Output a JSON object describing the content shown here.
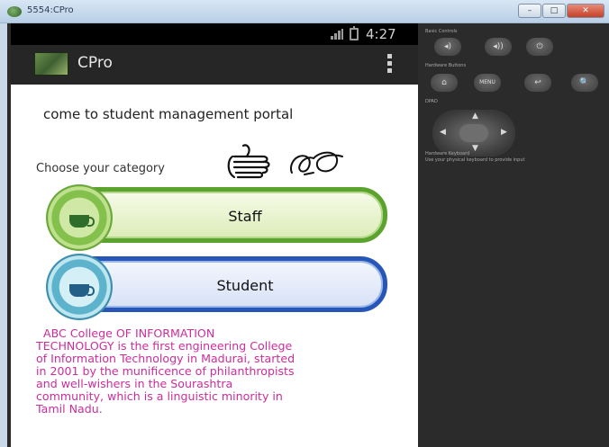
{
  "window": {
    "title": "5554:CPro",
    "min_label": "–",
    "max_label": "□",
    "close_label": "✕"
  },
  "status_bar": {
    "time": "4:27"
  },
  "action_bar": {
    "title": "CPro"
  },
  "content": {
    "welcome": "come to student management portal",
    "category_prompt": "Choose your category",
    "options": [
      {
        "label": "Staff",
        "accent": "#5aa32c"
      },
      {
        "label": "Student",
        "accent": "#2656b8"
      }
    ],
    "about_lines": [
      "ABC College OF INFORMATION",
      "TECHNOLOGY is the first engineering College",
      "of Information Technology in Madurai, started",
      "in 2001 by the munificence of philanthropists",
      "and well-wishers in the Sourashtra",
      "community, which is a linguistic minority in",
      "Tamil Nadu."
    ],
    "about_color": "#cc2d9b"
  },
  "emulator_panel": {
    "basic_controls_label": "Basic Controls",
    "hardware_buttons_label": "Hardware Buttons",
    "dpad_label": "DPAD",
    "keyboard_label": "Hardware Keyboard",
    "keyboard_hint": "Use your physical keyboard to provide input",
    "buttons": {
      "volume_down": "◂)",
      "volume_up": "◂))",
      "power": "⏻",
      "home": "⌂",
      "menu": "MENU",
      "back": "↩",
      "search": "🔍"
    }
  }
}
